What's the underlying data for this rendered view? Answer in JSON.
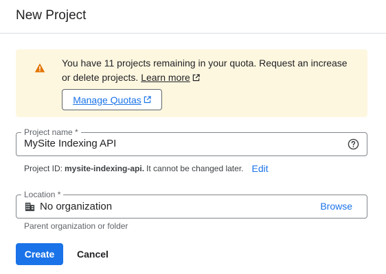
{
  "dialog": {
    "title": "New Project"
  },
  "quota_banner": {
    "icon": "warning-icon",
    "message": "You have 11 projects remaining in your quota. Request an increase or delete projects.",
    "learn_more_label": "Learn more",
    "manage_quotas_label": "Manage Quotas"
  },
  "project_name_field": {
    "label": "Project name *",
    "value": "MySite Indexing API",
    "help_icon": "help-circle-icon"
  },
  "project_id": {
    "prefix": "Project ID:",
    "value": "mysite-indexing-api.",
    "note": "It cannot be changed later.",
    "edit_label": "Edit"
  },
  "location_field": {
    "label": "Location *",
    "value": "No organization",
    "icon": "building-icon",
    "browse_label": "Browse",
    "helper": "Parent organization or folder"
  },
  "actions": {
    "create_label": "Create",
    "cancel_label": "Cancel"
  },
  "colors": {
    "primary": "#1a73e8",
    "banner_bg": "#fef7e0",
    "warning": "#e37400",
    "border": "#80868b",
    "divider": "#dadce0",
    "text": "#202124",
    "secondary_text": "#5f6368"
  }
}
